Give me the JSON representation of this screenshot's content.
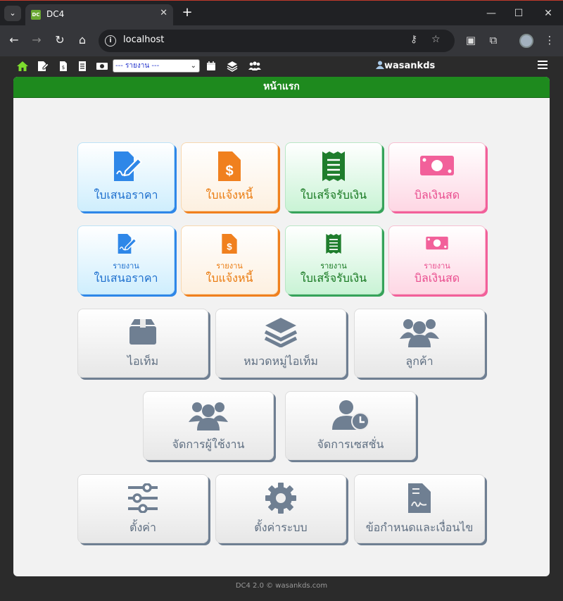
{
  "browser": {
    "tab_title": "DC4",
    "url": "localhost"
  },
  "nav": {
    "report_select": "--- รายงาน ---",
    "username": "wasankds"
  },
  "page": {
    "header": "หน้าแรก"
  },
  "tiles_row1": [
    {
      "label": "ใบเสนอราคา",
      "icon": "file-signature-icon"
    },
    {
      "label": "ใบแจ้งหนี้",
      "icon": "file-invoice-dollar-icon"
    },
    {
      "label": "ใบเสร็จรับเงิน",
      "icon": "receipt-icon"
    },
    {
      "label": "บิลเงินสด",
      "icon": "money-bill-icon"
    }
  ],
  "tiles_row2": [
    {
      "sub": "รายงาน",
      "label": "ใบเสนอราคา"
    },
    {
      "sub": "รายงาน",
      "label": "ใบแจ้งหนี้"
    },
    {
      "sub": "รายงาน",
      "label": "ใบเสร็จรับเงิน"
    },
    {
      "sub": "รายงาน",
      "label": "บิลเงินสด"
    }
  ],
  "tiles_gray": [
    {
      "label": "ไอเท็ม",
      "icon": "box-icon"
    },
    {
      "label": "หมวดหมู่ไอเท็ม",
      "icon": "layers-icon"
    },
    {
      "label": "ลูกค้า",
      "icon": "users-icon"
    },
    {
      "label": "จัดการผู้ใช้งาน",
      "icon": "users-icon"
    },
    {
      "label": "จัดการเซสชั่น",
      "icon": "user-clock-icon"
    },
    {
      "label": "ตั้งค่า",
      "icon": "sliders-icon"
    },
    {
      "label": "ตั้งค่าระบบ",
      "icon": "gear-icon"
    },
    {
      "label": "ข้อกำหนดและเงื่อนไข",
      "icon": "file-contract-icon"
    }
  ],
  "footer": {
    "version": "DC4 2.0 © wasankds.com"
  },
  "colors": {
    "header_green": "#1e8a1e",
    "blue": "#2e87e8",
    "orange": "#f0801e",
    "green": "#36a35a",
    "pink": "#f2609a",
    "gray": "#6f7f92"
  }
}
